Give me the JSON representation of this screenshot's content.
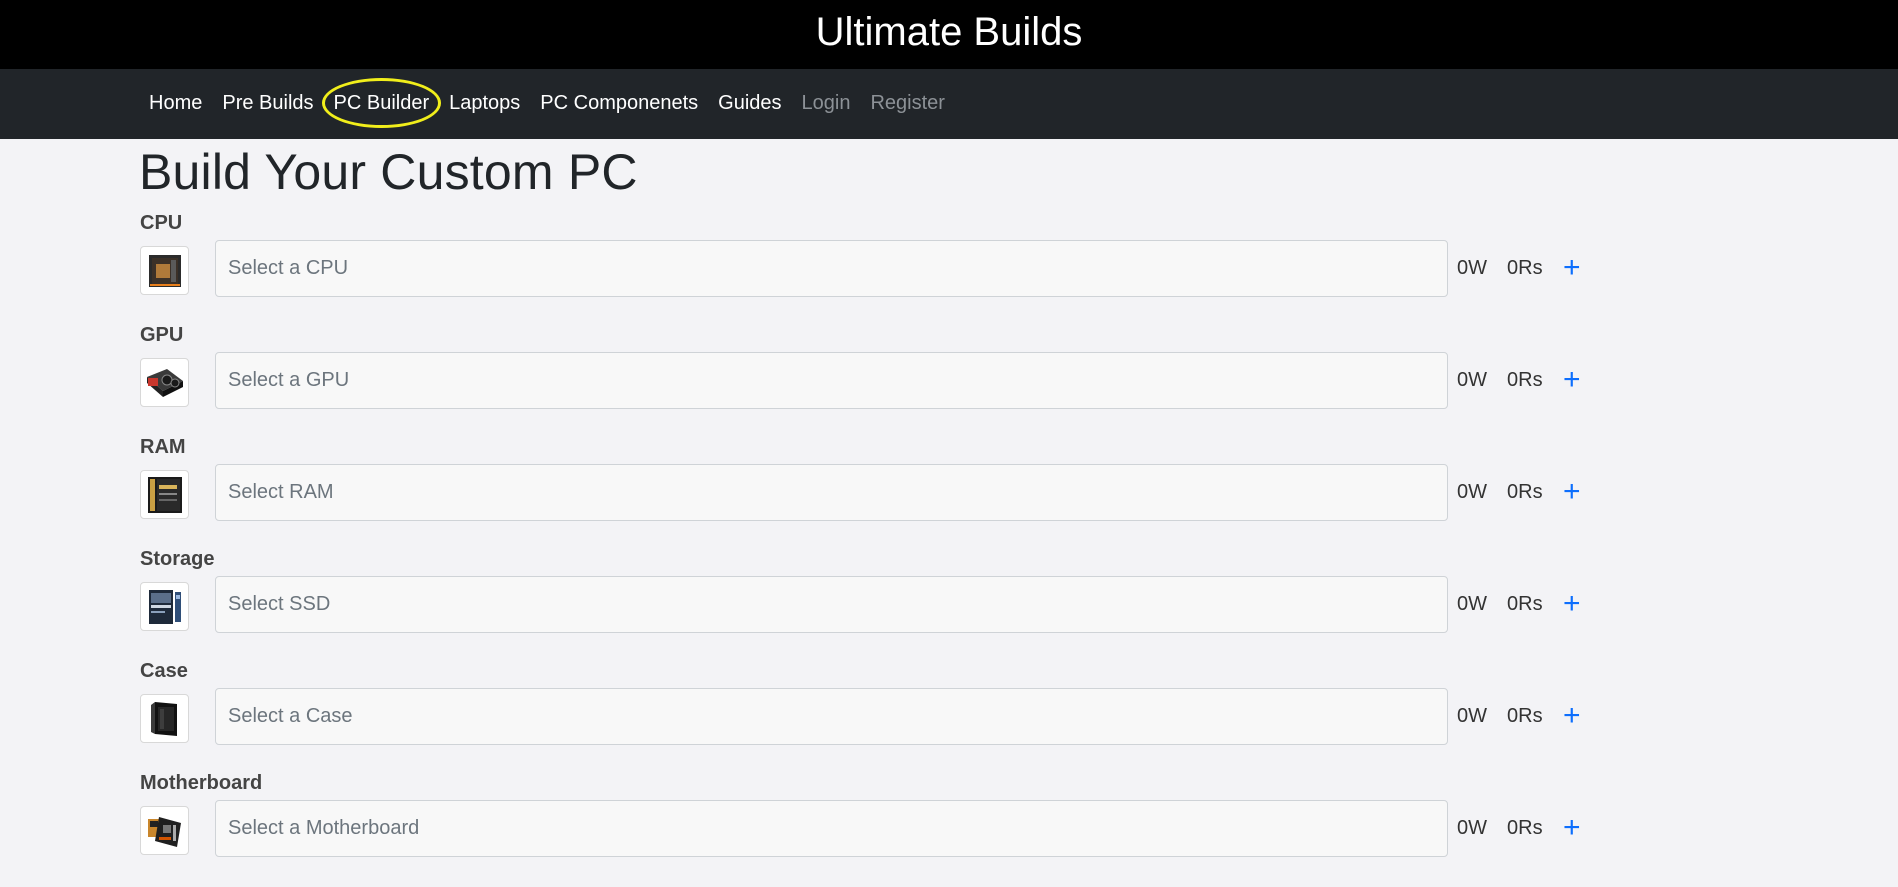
{
  "header": {
    "title": "Ultimate Builds"
  },
  "nav": {
    "items": [
      {
        "label": "Home",
        "muted": false,
        "active": false
      },
      {
        "label": "Pre Builds",
        "muted": false,
        "active": false
      },
      {
        "label": "PC Builder",
        "muted": false,
        "active": true
      },
      {
        "label": "Laptops",
        "muted": false,
        "active": false
      },
      {
        "label": "PC Componenets",
        "muted": false,
        "active": false
      },
      {
        "label": "Guides",
        "muted": false,
        "active": false
      },
      {
        "label": "Login",
        "muted": true,
        "active": false
      },
      {
        "label": "Register",
        "muted": true,
        "active": false
      }
    ]
  },
  "page": {
    "title": "Build Your Custom PC"
  },
  "components": [
    {
      "label": "CPU",
      "placeholder": "Select a CPU",
      "watts": "0W",
      "price": "0Rs",
      "add": "+",
      "icon": "cpu-icon"
    },
    {
      "label": "GPU",
      "placeholder": "Select a GPU",
      "watts": "0W",
      "price": "0Rs",
      "add": "+",
      "icon": "gpu-icon"
    },
    {
      "label": "RAM",
      "placeholder": "Select RAM",
      "watts": "0W",
      "price": "0Rs",
      "add": "+",
      "icon": "ram-icon"
    },
    {
      "label": "Storage",
      "placeholder": "Select SSD",
      "watts": "0W",
      "price": "0Rs",
      "add": "+",
      "icon": "ssd-icon"
    },
    {
      "label": "Case",
      "placeholder": "Select a Case",
      "watts": "0W",
      "price": "0Rs",
      "add": "+",
      "icon": "case-icon"
    },
    {
      "label": "Motherboard",
      "placeholder": "Select a Motherboard",
      "watts": "0W",
      "price": "0Rs",
      "add": "+",
      "icon": "motherboard-icon"
    }
  ],
  "colors": {
    "header_bg": "#000000",
    "navbar_bg": "#212529",
    "page_bg": "#f3f3f6",
    "accent": "#0d6efd",
    "highlight": "#f1ee1b"
  }
}
